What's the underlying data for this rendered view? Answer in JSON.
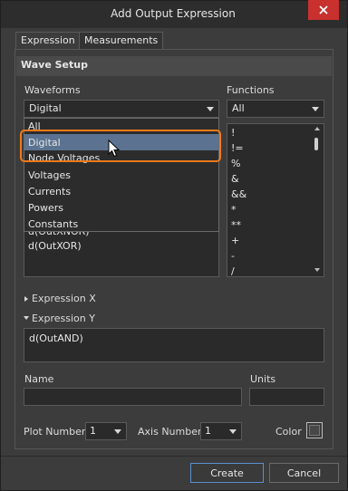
{
  "window": {
    "title": "Add Output Expression"
  },
  "tabs": [
    {
      "label": "Expression",
      "active": true
    },
    {
      "label": "Measurements",
      "active": false
    }
  ],
  "wave_setup": {
    "header": "Wave Setup",
    "waveforms_label": "Waveforms",
    "waveforms_value": "Digital",
    "functions_label": "Functions",
    "functions_value": "All",
    "waveform_list_visible": [
      "d(OutXNOR)",
      "d(OutXOR)"
    ],
    "dropdown_options": [
      "All",
      "Digital",
      "Node Voltages",
      "Voltages",
      "Currents",
      "Powers",
      "Constants"
    ],
    "dropdown_selected": "Digital",
    "functions_list": [
      "!",
      "!=",
      "%",
      "&",
      "&&",
      "*",
      "**",
      "+",
      "-",
      "/"
    ]
  },
  "expression_x": {
    "label": "Expression X"
  },
  "expression_y": {
    "label": "Expression Y",
    "value": "d(OutAND)"
  },
  "name_field": {
    "label": "Name",
    "value": ""
  },
  "units_field": {
    "label": "Units",
    "value": ""
  },
  "plot": {
    "plot_number_label": "Plot Number",
    "plot_number_value": "1",
    "axis_number_label": "Axis Number",
    "axis_number_value": "1",
    "color_label": "Color"
  },
  "buttons": {
    "create": "Create",
    "cancel": "Cancel"
  },
  "colors": {
    "accent_highlight": "#f07a1c",
    "selection": "#5b7390",
    "close_button": "#c8312e",
    "primary_border": "#5b8fcf"
  }
}
